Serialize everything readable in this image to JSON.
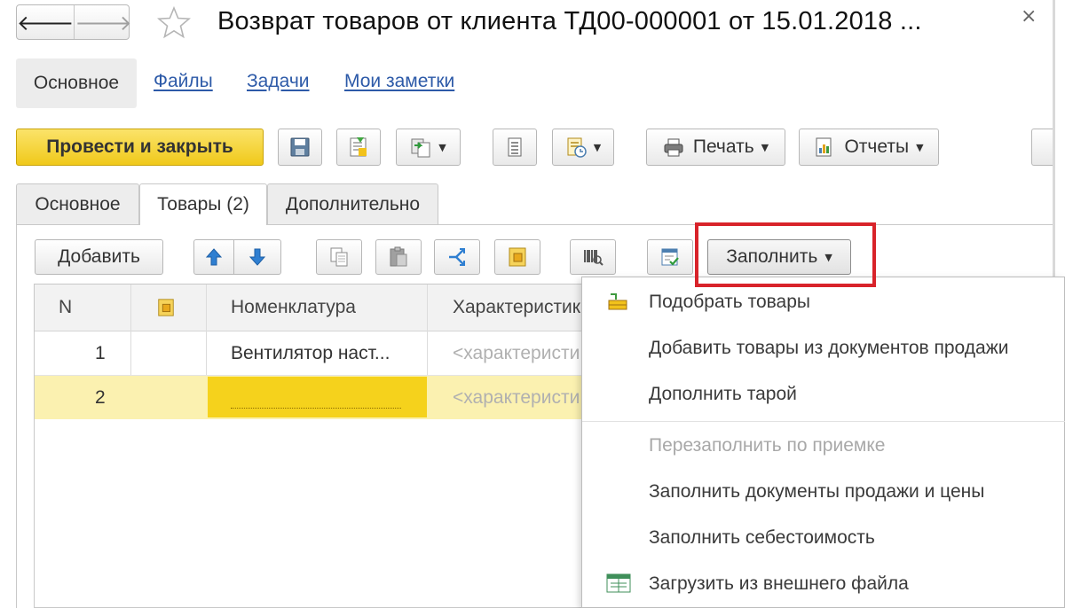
{
  "header": {
    "title": "Возврат товаров от клиента ТД00-000001 от 15.01.2018 ...",
    "back_glyph": "🡐",
    "forward_glyph": "🡒",
    "close_glyph": "×"
  },
  "section_nav": {
    "active": "Основное",
    "links": [
      "Файлы",
      "Задачи",
      "Мои заметки"
    ]
  },
  "command_bar": {
    "post_and_close": "Провести и закрыть",
    "print": "Печать",
    "reports": "Отчеты",
    "icons": [
      "save-icon",
      "post-icon",
      "create-based-on-icon",
      "structure-icon",
      "related-documents-icon",
      "printer-icon",
      "reports-icon"
    ]
  },
  "tabs": [
    {
      "label": "Основное",
      "active": false
    },
    {
      "label": "Товары (2)",
      "active": true
    },
    {
      "label": "Дополнительно",
      "active": false
    }
  ],
  "table_toolbar": {
    "add": "Добавить",
    "fill": "Заполнить"
  },
  "table": {
    "columns": [
      "N",
      "",
      "Номенклатура",
      "Характеристик"
    ],
    "rows": [
      {
        "n": "1",
        "item": "Вентилятор наст...",
        "characteristic": "<характеристи"
      },
      {
        "n": "2",
        "item": "",
        "characteristic": "<характеристи"
      }
    ]
  },
  "fill_menu": {
    "items": [
      {
        "label": "Подобрать товары",
        "enabled": true,
        "icon": "pick-items-icon"
      },
      {
        "label": "Добавить товары из документов продажи",
        "enabled": true
      },
      {
        "label": "Дополнить тарой",
        "enabled": true
      },
      {
        "label": "Перезаполнить по приемке",
        "enabled": false
      },
      {
        "label": "Заполнить документы продажи и цены",
        "enabled": true
      },
      {
        "label": "Заполнить себестоимость",
        "enabled": true
      },
      {
        "label": "Загрузить из внешнего файла",
        "enabled": true,
        "icon": "load-file-icon"
      }
    ]
  },
  "colors": {
    "accent_yellow": "#f5d21c",
    "highlight_red": "#d8232a",
    "selected_row": "#fbf1b0",
    "link_blue": "#2d5aa8"
  }
}
